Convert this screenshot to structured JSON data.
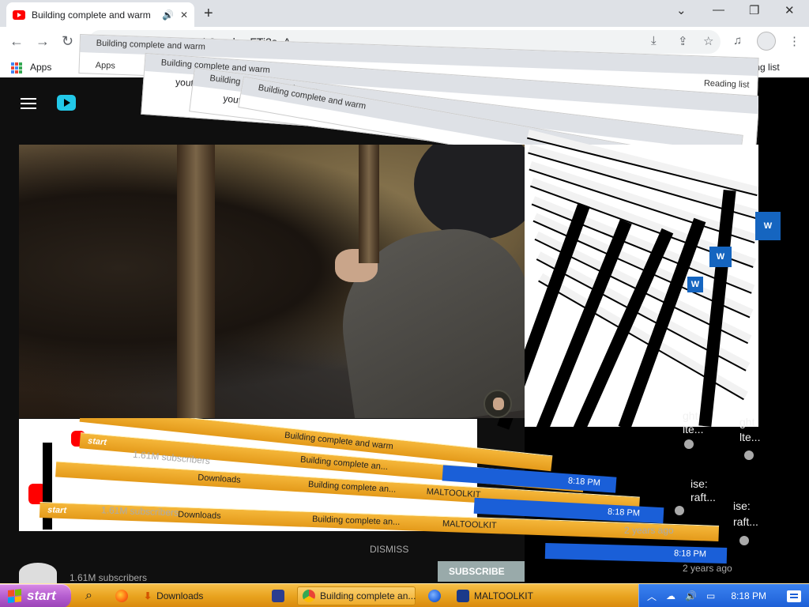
{
  "browser": {
    "tab_title": "Building complete and warm",
    "url": "youtube.com/watch?v=skcqFTi3s_A",
    "new_tab_label": "+",
    "bookmarks": {
      "apps_label": "Apps",
      "reading_list_label": "Reading list"
    },
    "icons": {
      "back": "←",
      "forward": "→",
      "reload": "↻",
      "download": "⤓",
      "share": "⇪",
      "star": "☆",
      "media": "♫",
      "menu": "⋮",
      "minimize": "—",
      "restore": "❐",
      "close": "✕",
      "tab_audio": "🔊",
      "tab_close": "✕",
      "chevron": "⌄"
    }
  },
  "trails": {
    "tab_title_fragment": "Building complete and warm",
    "url_fragment": "youtube.com/watch?v=skcqFTi3s_A",
    "reading_list": "Reading list",
    "apps": "Apps",
    "subscribers": "1.61M subscribers",
    "subscribe": "SUBSCRIBE",
    "dismiss": "DISMISS",
    "years_ago": "2 years ago",
    "side_texts": [
      "ght",
      "lte...",
      "ise:",
      "raft...",
      "ght",
      "lte...",
      "ise:",
      "raft..."
    ],
    "blue_btn": "W",
    "clock": "8:18 PM"
  },
  "taskbar": {
    "start_label": "start",
    "items": [
      {
        "label": "Downloads",
        "icon": "folder-icon"
      },
      {
        "label": "Building complete an...",
        "icon": "chrome-icon"
      },
      {
        "label": "MALTOOLKIT",
        "icon": "app-icon"
      }
    ],
    "clock": "8:18 PM"
  },
  "colors": {
    "youtube_red": "#ff0000",
    "taskbar_orange": "#e8a21e",
    "start_purple": "#b65fd0",
    "tray_blue": "#1d5fd6"
  }
}
